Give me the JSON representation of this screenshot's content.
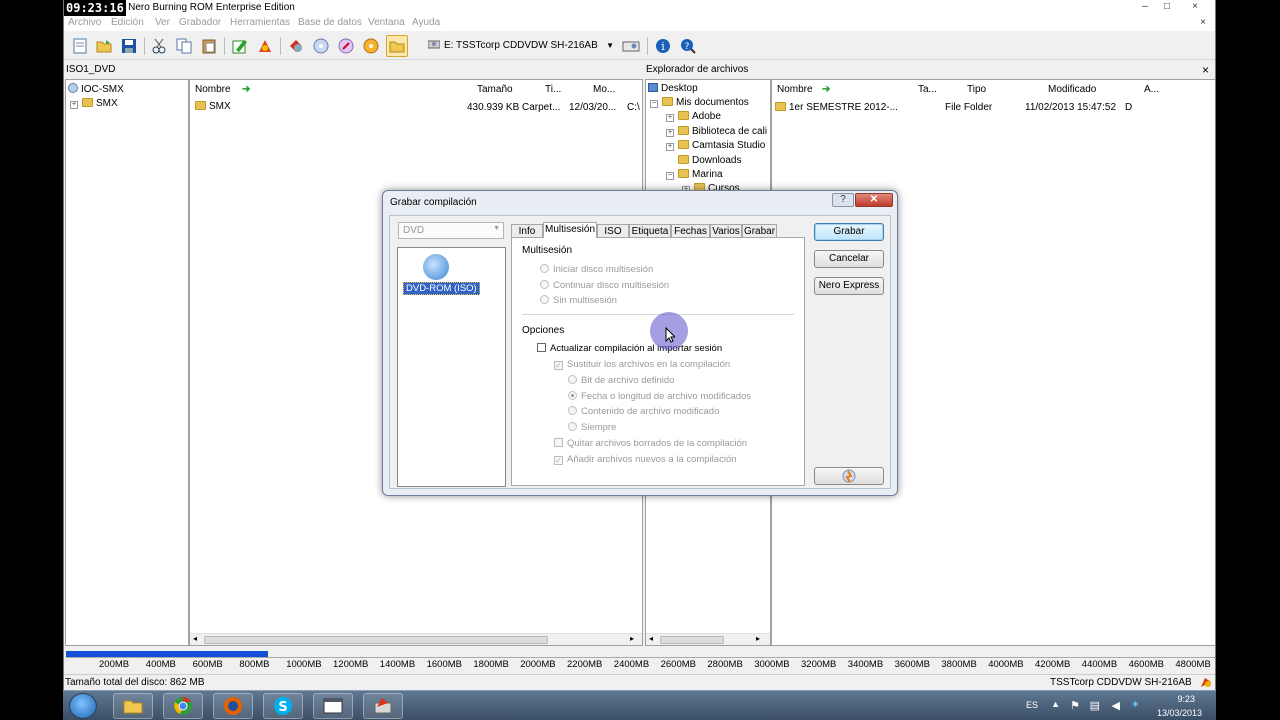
{
  "app": {
    "clock_overlay": "09:23:16",
    "title": "D - Nero Burning ROM Enterprise Edition",
    "window_controls": [
      "–",
      "□",
      "×"
    ],
    "doc_close": "×"
  },
  "menu": [
    "Archivo",
    "Edición",
    "Ver",
    "Grabador",
    "Herramientas",
    "Base de datos",
    "Ventana",
    "Ayuda"
  ],
  "toolbar": {
    "drive": "E: TSSTcorp CDDVDW SH-216AB"
  },
  "compilation": {
    "name": "ISO1_DVD",
    "tree": [
      {
        "label": "IOC-SMX"
      },
      {
        "label": "SMX"
      }
    ],
    "columns": [
      "Nombre",
      "Tamaño",
      "Ti...",
      "Mo..."
    ],
    "rows": [
      {
        "name": "SMX",
        "size": "430.939 KB",
        "type": "Carpet...",
        "modified": "12/03/20...",
        "extra": "C:\\"
      }
    ]
  },
  "explorer": {
    "title": "Explorador de archivos",
    "close": "×",
    "tree": [
      "Desktop",
      "Mis documentos",
      "Adobe",
      "Biblioteca de cali",
      "Camtasia Studio",
      "Downloads",
      "Marina",
      "Cursos"
    ],
    "columns": [
      "Nombre",
      "Ta...",
      "Tipo",
      "Modificado",
      "A..."
    ],
    "rows": [
      {
        "name": "1er SEMESTRE 2012-...",
        "type": "File Folder",
        "modified": "11/02/2013 15:47:52",
        "attr": "D"
      }
    ]
  },
  "capacity": {
    "fill_fraction": 0.0431,
    "ticks": [
      "200MB",
      "400MB",
      "600MB",
      "800MB",
      "1000MB",
      "1200MB",
      "1400MB",
      "1600MB",
      "1800MB",
      "2000MB",
      "2200MB",
      "2400MB",
      "2600MB",
      "2800MB",
      "3000MB",
      "3200MB",
      "3400MB",
      "3600MB",
      "3800MB",
      "4000MB",
      "4200MB",
      "4400MB",
      "4600MB",
      "4800MB"
    ]
  },
  "status": {
    "total": "Tamaño total del disco: 862 MB",
    "drive": "TSSTcorp CDDVDW SH-216AB"
  },
  "dialog": {
    "title": "Grabar compilación",
    "help": "?",
    "close": "✕",
    "disc_type": "DVD",
    "disc_item": "DVD-ROM (ISO)",
    "tabs": [
      "Info",
      "Multisesión",
      "ISO",
      "Etiqueta",
      "Fechas",
      "Varios",
      "Grabar"
    ],
    "multisession": {
      "heading": "Multisesión",
      "options": [
        "Iniciar disco multisesión",
        "Continuar disco multisesión",
        "Sin multisesión"
      ]
    },
    "options": {
      "heading": "Opciones",
      "update_on_import": "Actualizar compilación al importar sesión",
      "replace_files": "Sustituir los archivos en la compilación",
      "archive_bit": "Bit de archivo definido",
      "date_or_length": "Fecha o longitud de archivo modificados",
      "content_modified": "Contenido de archivo modificado",
      "always": "Siempre",
      "remove_deleted": "Quitar archivos borrados de la compilación",
      "add_new": "Añadir archivos nuevos a la compilación"
    },
    "buttons": {
      "burn": "Grabar",
      "cancel": "Cancelar",
      "express": "Nero Express"
    }
  },
  "taskbar": {
    "lang": "ES",
    "time": "9:23",
    "date": "13/03/2013"
  }
}
